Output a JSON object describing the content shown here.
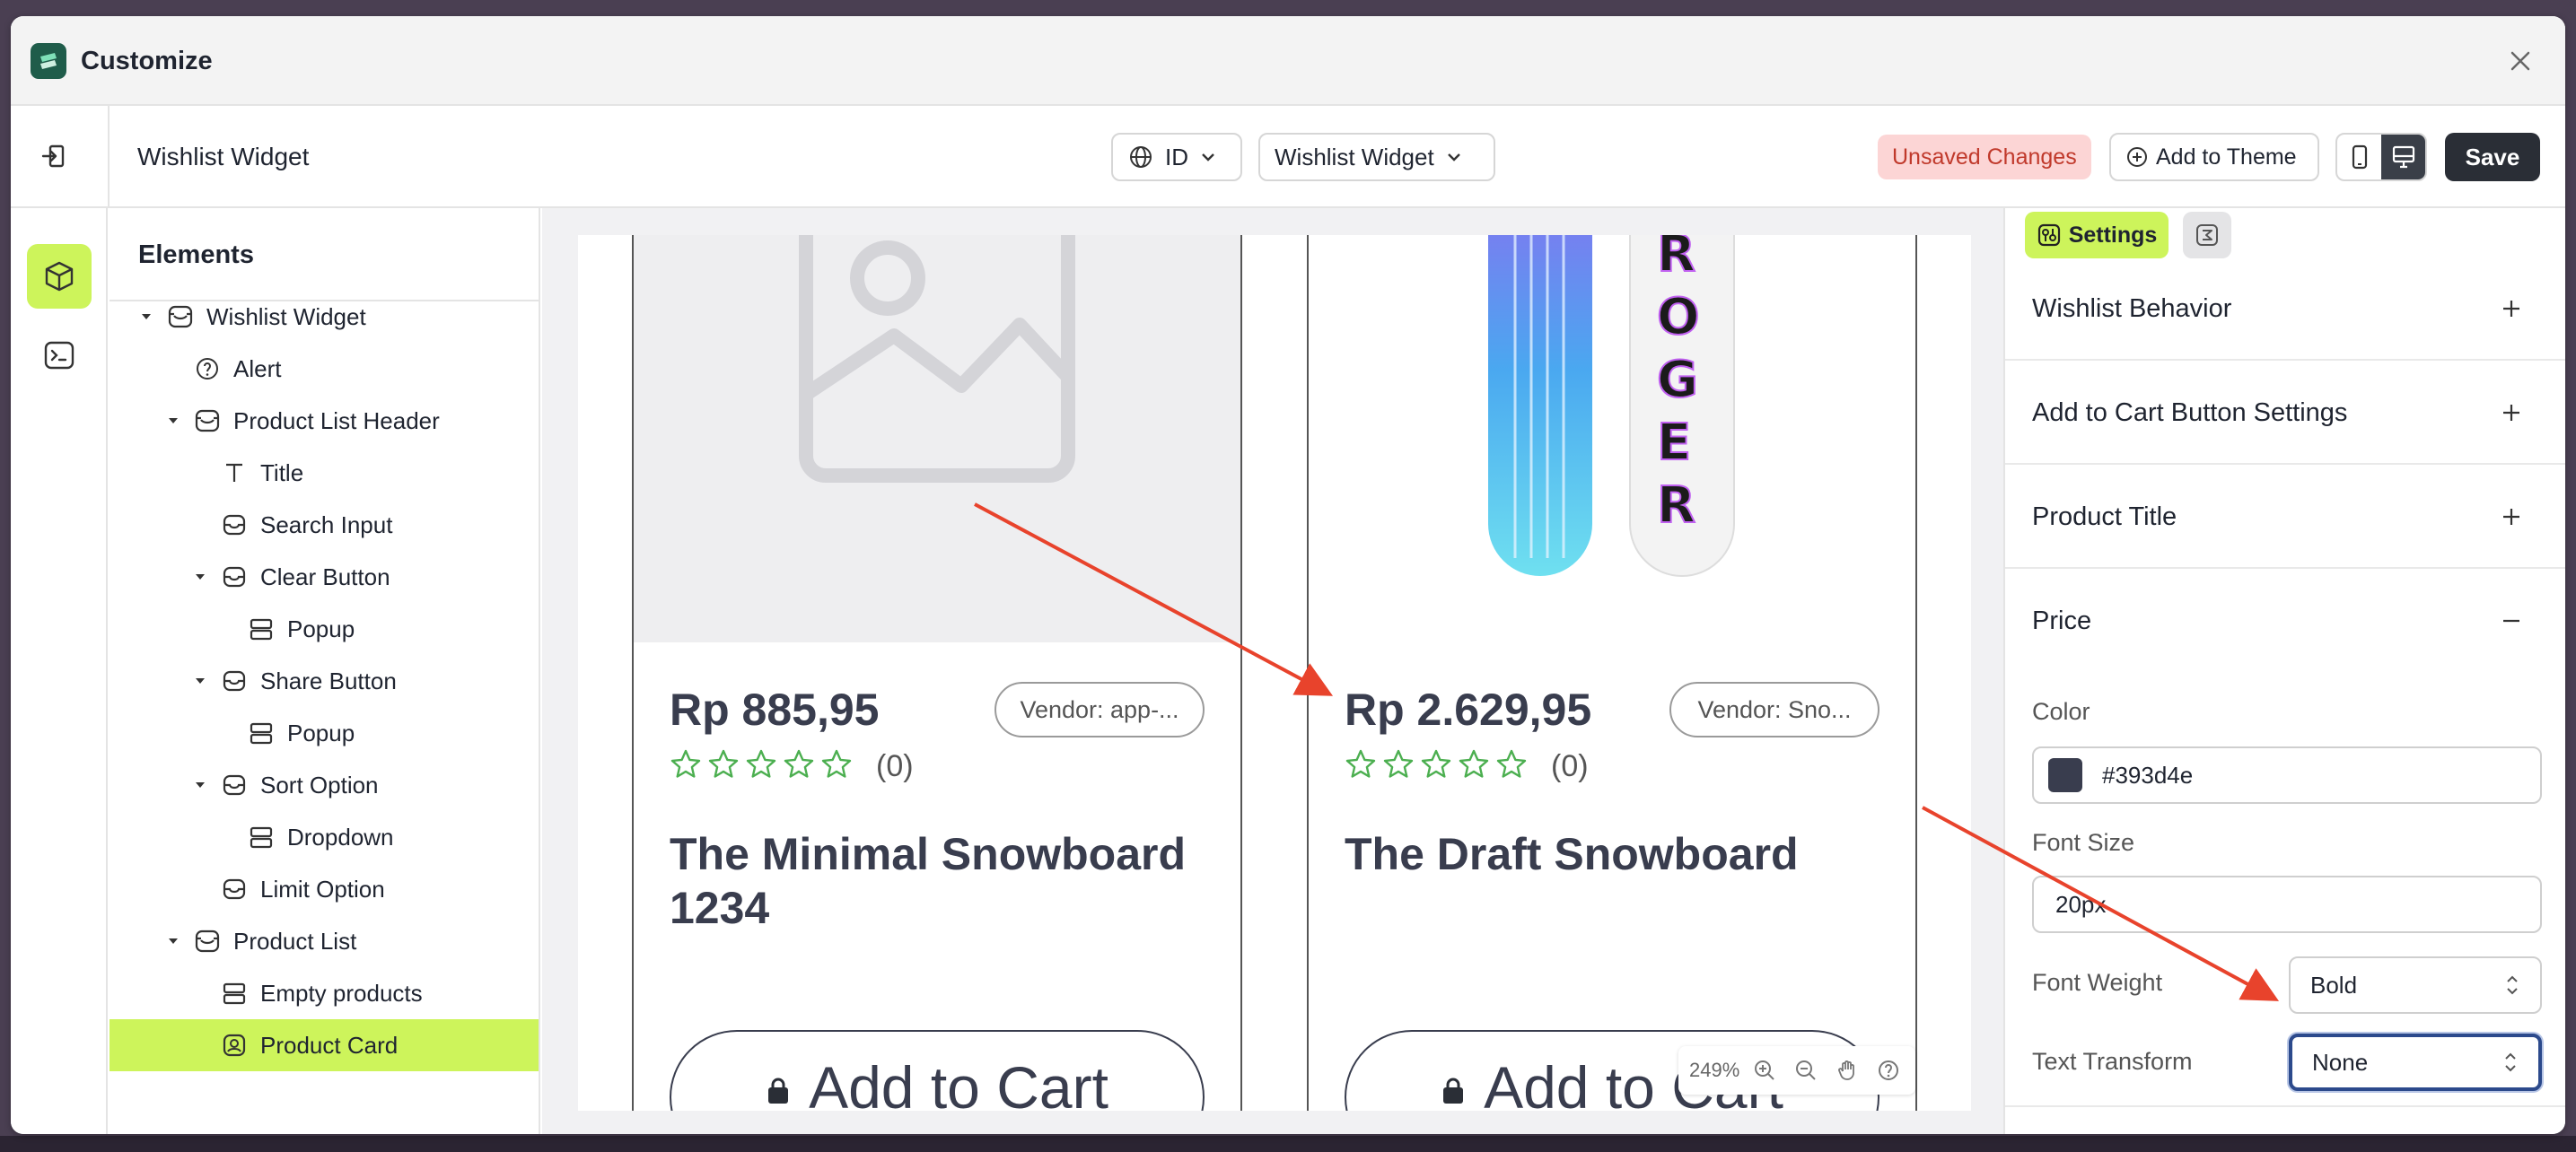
{
  "window": {
    "title": "Customize"
  },
  "toolbar": {
    "page_name": "Wishlist Widget",
    "language": "ID",
    "widget_select": "Wishlist Widget",
    "unsaved_badge": "Unsaved Changes",
    "add_to_theme": "Add to Theme",
    "save": "Save"
  },
  "tree": {
    "title": "Elements",
    "items": [
      {
        "label": "Wishlist Widget",
        "icon": "widget-icon",
        "expanded": true
      },
      {
        "label": "Alert",
        "icon": "help-circle-icon"
      },
      {
        "label": "Product List Header",
        "icon": "widget-icon",
        "expanded": true
      },
      {
        "label": "Title",
        "icon": "text-icon"
      },
      {
        "label": "Search Input",
        "icon": "inbox-icon"
      },
      {
        "label": "Clear Button",
        "icon": "inbox-icon",
        "expanded": true
      },
      {
        "label": "Popup",
        "icon": "layout-icon"
      },
      {
        "label": "Share Button",
        "icon": "inbox-icon",
        "expanded": true
      },
      {
        "label": "Popup",
        "icon": "layout-icon"
      },
      {
        "label": "Sort Option",
        "icon": "inbox-icon",
        "expanded": true
      },
      {
        "label": "Dropdown",
        "icon": "layout-icon"
      },
      {
        "label": "Limit Option",
        "icon": "inbox-icon"
      },
      {
        "label": "Product List",
        "icon": "widget-icon",
        "expanded": true
      },
      {
        "label": "Empty products",
        "icon": "layout-icon"
      },
      {
        "label": "Product Card",
        "icon": "card-icon",
        "selected": true
      }
    ]
  },
  "preview": {
    "cards": [
      {
        "price": "Rp 885,95",
        "vendor": "Vendor: app-...",
        "rating_count": "(0)",
        "title": "The Minimal Snowboard 1234",
        "button": "Add to Cart",
        "image": "placeholder-image-icon"
      },
      {
        "price": "Rp 2.629,95",
        "vendor": "Vendor: Sno...",
        "rating_count": "(0)",
        "title": "The Draft Snowboard",
        "button": "Add to Cart",
        "image": "snowboard-image"
      }
    ],
    "zoom": "249%"
  },
  "settings": {
    "tab_settings": "Settings",
    "sections": [
      {
        "label": "Wishlist Behavior",
        "expanded": false
      },
      {
        "label": "Add to Cart Button Settings",
        "expanded": false
      },
      {
        "label": "Product Title",
        "expanded": false
      },
      {
        "label": "Price",
        "expanded": true
      }
    ],
    "price": {
      "color_label": "Color",
      "color_value": "#393d4e",
      "font_size_label": "Font Size",
      "font_size_value": "20px",
      "font_weight_label": "Font Weight",
      "font_weight_value": "Bold",
      "text_transform_label": "Text Transform",
      "text_transform_value": "None"
    }
  },
  "colors": {
    "accent": "#cdf45b",
    "text_dark": "#393d4e",
    "danger_bg": "#fcd5d5",
    "danger_text": "#c0392b",
    "arrow": "#e8432c"
  }
}
